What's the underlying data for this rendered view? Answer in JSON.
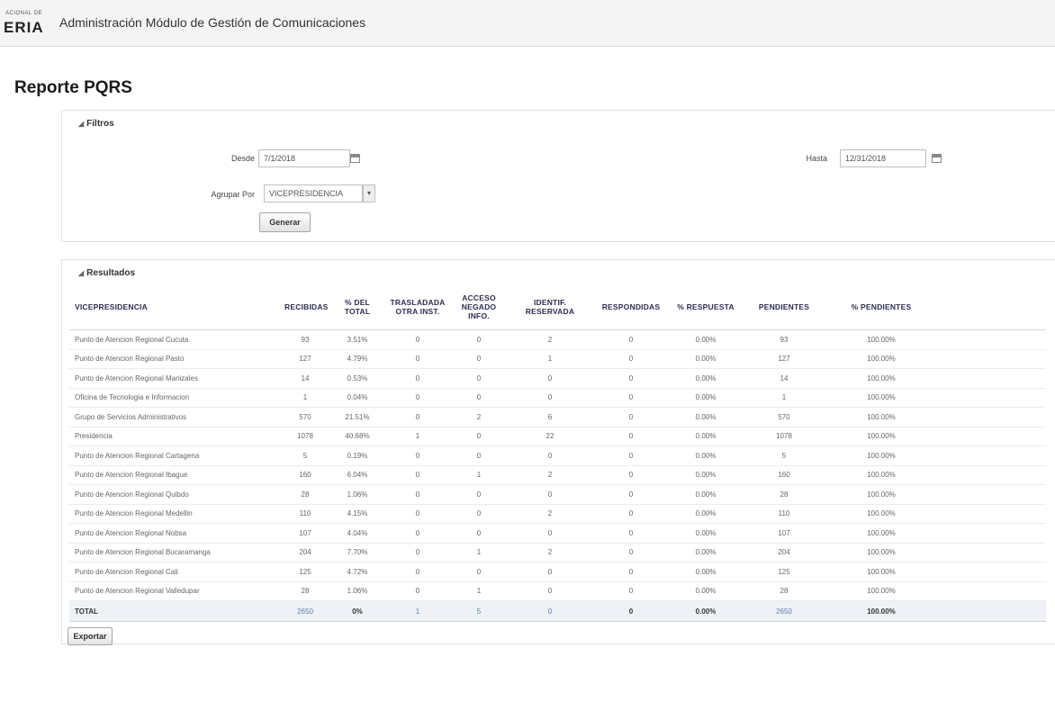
{
  "header": {
    "logo_small": "ACIONAL DE",
    "logo_big": "ERIA",
    "app_title": "Administración Módulo de Gestión de Comunicaciones"
  },
  "page_title": "Reporte PQRS",
  "filters": {
    "section_title": "Filtros",
    "desde_label": "Desde",
    "desde_value": "7/1/2018",
    "hasta_label": "Hasta",
    "hasta_value": "12/31/2018",
    "agrupar_label": "Agrupar Por",
    "agrupar_value": "VICEPRESIDENCIA",
    "generate_button": "Generar"
  },
  "results": {
    "section_title": "Resultados",
    "columns": [
      "VICEPRESIDENCIA",
      "RECIBIDAS",
      "% DEL TOTAL",
      "TRASLADADA OTRA INST.",
      "ACCESO NEGADO INFO.",
      "IDENTIF. RESERVADA",
      "RESPONDIDAS",
      "% RESPUESTA",
      "PENDIENTES",
      "% PENDIENTES"
    ],
    "rows": [
      [
        "Punto de Atencion Regional Cucuta",
        "93",
        "3.51%",
        "0",
        "0",
        "2",
        "0",
        "0.00%",
        "93",
        "100.00%"
      ],
      [
        "Punto de Atencion Regional Pasto",
        "127",
        "4.79%",
        "0",
        "0",
        "1",
        "0",
        "0.00%",
        "127",
        "100.00%"
      ],
      [
        "Punto de Atencion Regional Manizales",
        "14",
        "0.53%",
        "0",
        "0",
        "0",
        "0",
        "0.00%",
        "14",
        "100.00%"
      ],
      [
        "Oficina de Tecnologia e Informacion",
        "1",
        "0.04%",
        "0",
        "0",
        "0",
        "0",
        "0.00%",
        "1",
        "100.00%"
      ],
      [
        "Grupo de Servicios Administrativos",
        "570",
        "21.51%",
        "0",
        "2",
        "6",
        "0",
        "0.00%",
        "570",
        "100.00%"
      ],
      [
        "Presidencia",
        "1078",
        "40.68%",
        "1",
        "0",
        "22",
        "0",
        "0.00%",
        "1078",
        "100.00%"
      ],
      [
        "Punto de Atencion Regional Cartagena",
        "5",
        "0.19%",
        "0",
        "0",
        "0",
        "0",
        "0.00%",
        "5",
        "100.00%"
      ],
      [
        "Punto de Atencion Regional Ibague",
        "160",
        "6.04%",
        "0",
        "1",
        "2",
        "0",
        "0.00%",
        "160",
        "100.00%"
      ],
      [
        "Punto de Atencion Regional Quibdo",
        "28",
        "1.06%",
        "0",
        "0",
        "0",
        "0",
        "0.00%",
        "28",
        "100.00%"
      ],
      [
        "Punto de Atencion Regional Medellin",
        "110",
        "4.15%",
        "0",
        "0",
        "2",
        "0",
        "0.00%",
        "110",
        "100.00%"
      ],
      [
        "Punto de Atencion Regional Nobsa",
        "107",
        "4.04%",
        "0",
        "0",
        "0",
        "0",
        "0.00%",
        "107",
        "100.00%"
      ],
      [
        "Punto de Atencion Regional Bucaramanga",
        "204",
        "7.70%",
        "0",
        "1",
        "2",
        "0",
        "0.00%",
        "204",
        "100.00%"
      ],
      [
        "Punto de Atencion Regional Cali",
        "125",
        "4.72%",
        "0",
        "0",
        "0",
        "0",
        "0.00%",
        "125",
        "100.00%"
      ],
      [
        "Punto de Atencion Regional Valledupar",
        "28",
        "1.06%",
        "0",
        "1",
        "0",
        "0",
        "0.00%",
        "28",
        "100.00%"
      ]
    ],
    "total": [
      "TOTAL",
      "2650",
      "0%",
      "1",
      "5",
      "0",
      "0",
      "0.00%",
      "2650",
      "100.00%"
    ],
    "export_button": "Exportar"
  }
}
